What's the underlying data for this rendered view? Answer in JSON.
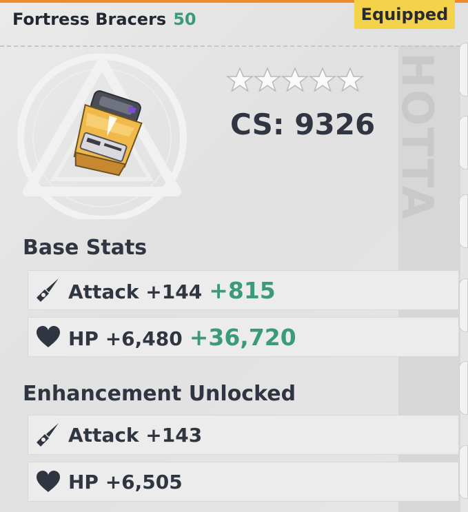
{
  "header": {
    "item_name": "Fortress Bracers",
    "level": "50",
    "equipped_label": "Equipped"
  },
  "item": {
    "stars_total": 5,
    "stars_filled": 0,
    "combat_score": "CS: 9326",
    "watermark": "HOTTA"
  },
  "base_stats": {
    "title": "Base Stats",
    "rows": [
      {
        "icon": "sword-icon",
        "label": "Attack +144",
        "bonus": "+815"
      },
      {
        "icon": "heart-icon",
        "label": "HP +6,480",
        "bonus": "+36,720"
      }
    ]
  },
  "enhancement": {
    "title": "Enhancement Unlocked",
    "rows": [
      {
        "icon": "sword-icon",
        "label": "Attack +143"
      },
      {
        "icon": "heart-icon",
        "label": "HP +6,505"
      }
    ]
  },
  "colors": {
    "accent_green": "#3a9a79",
    "equipped_yellow": "#f4d24a",
    "top_strip_orange": "#f08a2a"
  }
}
